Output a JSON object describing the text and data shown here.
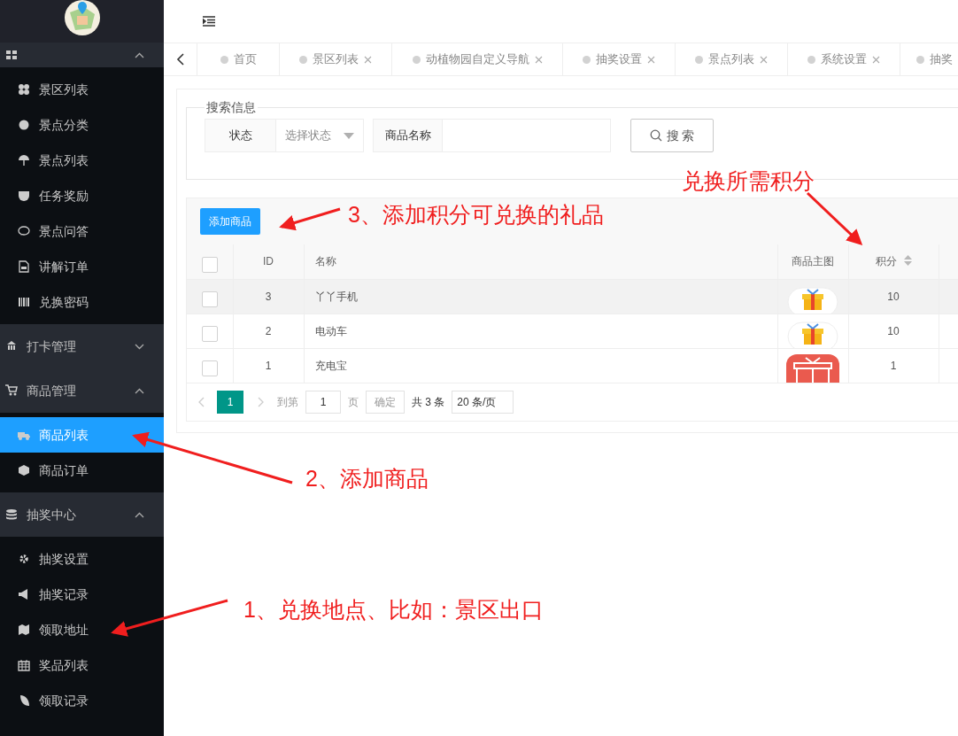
{
  "sidebar": {
    "groups": [
      {
        "expanded": true,
        "items": [
          {
            "label": "景区列表",
            "selected": false
          },
          {
            "label": "景点分类",
            "selected": false
          },
          {
            "label": "景点列表",
            "selected": false
          },
          {
            "label": "任务奖励",
            "selected": false
          },
          {
            "label": "景点问答",
            "selected": false
          },
          {
            "label": "讲解订单",
            "selected": false
          },
          {
            "label": "兑换密码",
            "selected": false
          }
        ]
      },
      {
        "label": "打卡管理",
        "expanded": false
      },
      {
        "label": "商品管理",
        "expanded": true,
        "items": [
          {
            "label": "商品列表",
            "selected": true
          },
          {
            "label": "商品订单",
            "selected": false
          }
        ]
      },
      {
        "label": "抽奖中心",
        "expanded": true,
        "items": [
          {
            "label": "抽奖设置",
            "selected": false
          },
          {
            "label": "抽奖记录",
            "selected": false
          },
          {
            "label": "领取地址",
            "selected": false
          },
          {
            "label": "奖品列表",
            "selected": false
          },
          {
            "label": "领取记录",
            "selected": false
          }
        ]
      }
    ]
  },
  "tabs": [
    {
      "label": "首页",
      "closable": false
    },
    {
      "label": "景区列表",
      "closable": true
    },
    {
      "label": "动植物园自定义导航",
      "closable": true
    },
    {
      "label": "抽奖设置",
      "closable": true
    },
    {
      "label": "景点列表",
      "closable": true
    },
    {
      "label": "系统设置",
      "closable": true
    },
    {
      "label": "抽奖",
      "closable": false
    }
  ],
  "search": {
    "legend": "搜索信息",
    "status_label": "状态",
    "status_placeholder": "选择状态",
    "name_label": "商品名称",
    "button": "搜 索"
  },
  "add_button": "添加商品",
  "table": {
    "columns": [
      "ID",
      "名称",
      "商品主图",
      "积分"
    ],
    "header_checked": false,
    "rows": [
      {
        "id": "3",
        "name": "丫丫手机",
        "kind": "round",
        "points": "10",
        "checked": false
      },
      {
        "id": "2",
        "name": "电动车",
        "kind": "round",
        "points": "10",
        "checked": false
      },
      {
        "id": "1",
        "name": "充电宝",
        "kind": "square",
        "points": "1",
        "checked": false
      }
    ]
  },
  "pager": {
    "page": "1",
    "goto_label": "到第",
    "goto_value": "1",
    "page_unit": "页",
    "confirm": "确定",
    "total": "共 3 条",
    "per_page": "20 条/页"
  },
  "annotations": [
    "兑换所需积分",
    "3、添加积分可兑换的礼品",
    "2、添加商品",
    "1、兑换地点、比如：景区出口"
  ]
}
